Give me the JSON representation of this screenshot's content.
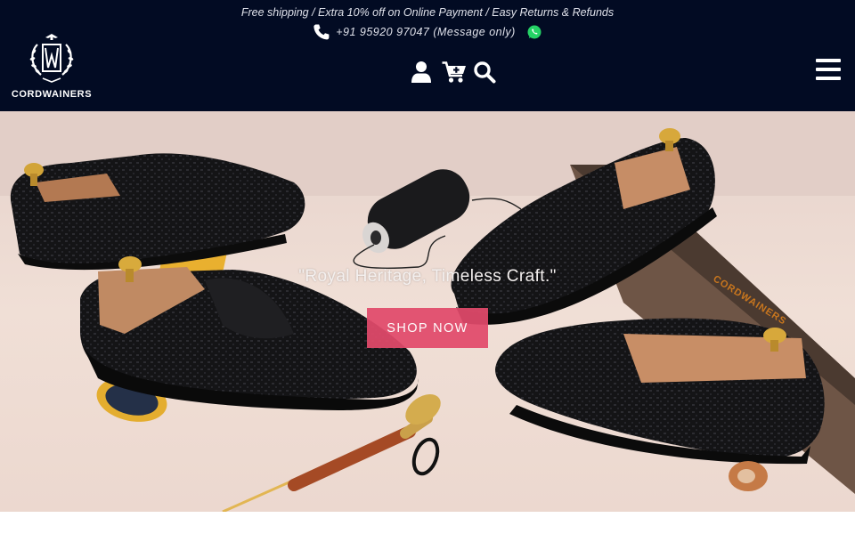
{
  "header": {
    "promo_text": "Free shipping / Extra 10% off on Online Payment / Easy Returns & Refunds",
    "phone_text": "+91 95920 97047 (Message only)",
    "brand_name": "CORDWAINERS",
    "icons": [
      "phone-icon",
      "whatsapp-icon",
      "user-icon",
      "cart-icon",
      "search-icon",
      "menu-icon"
    ]
  },
  "hero": {
    "tagline": "\"Royal Heritage, Timeless Craft.\"",
    "cta_label": "SHOP NOW",
    "box_brand": "CORDWAINERS"
  },
  "colors": {
    "header_bg": "#020b23",
    "cta_bg": "#e24a6b",
    "hero_bg": "#ecd9d1"
  }
}
